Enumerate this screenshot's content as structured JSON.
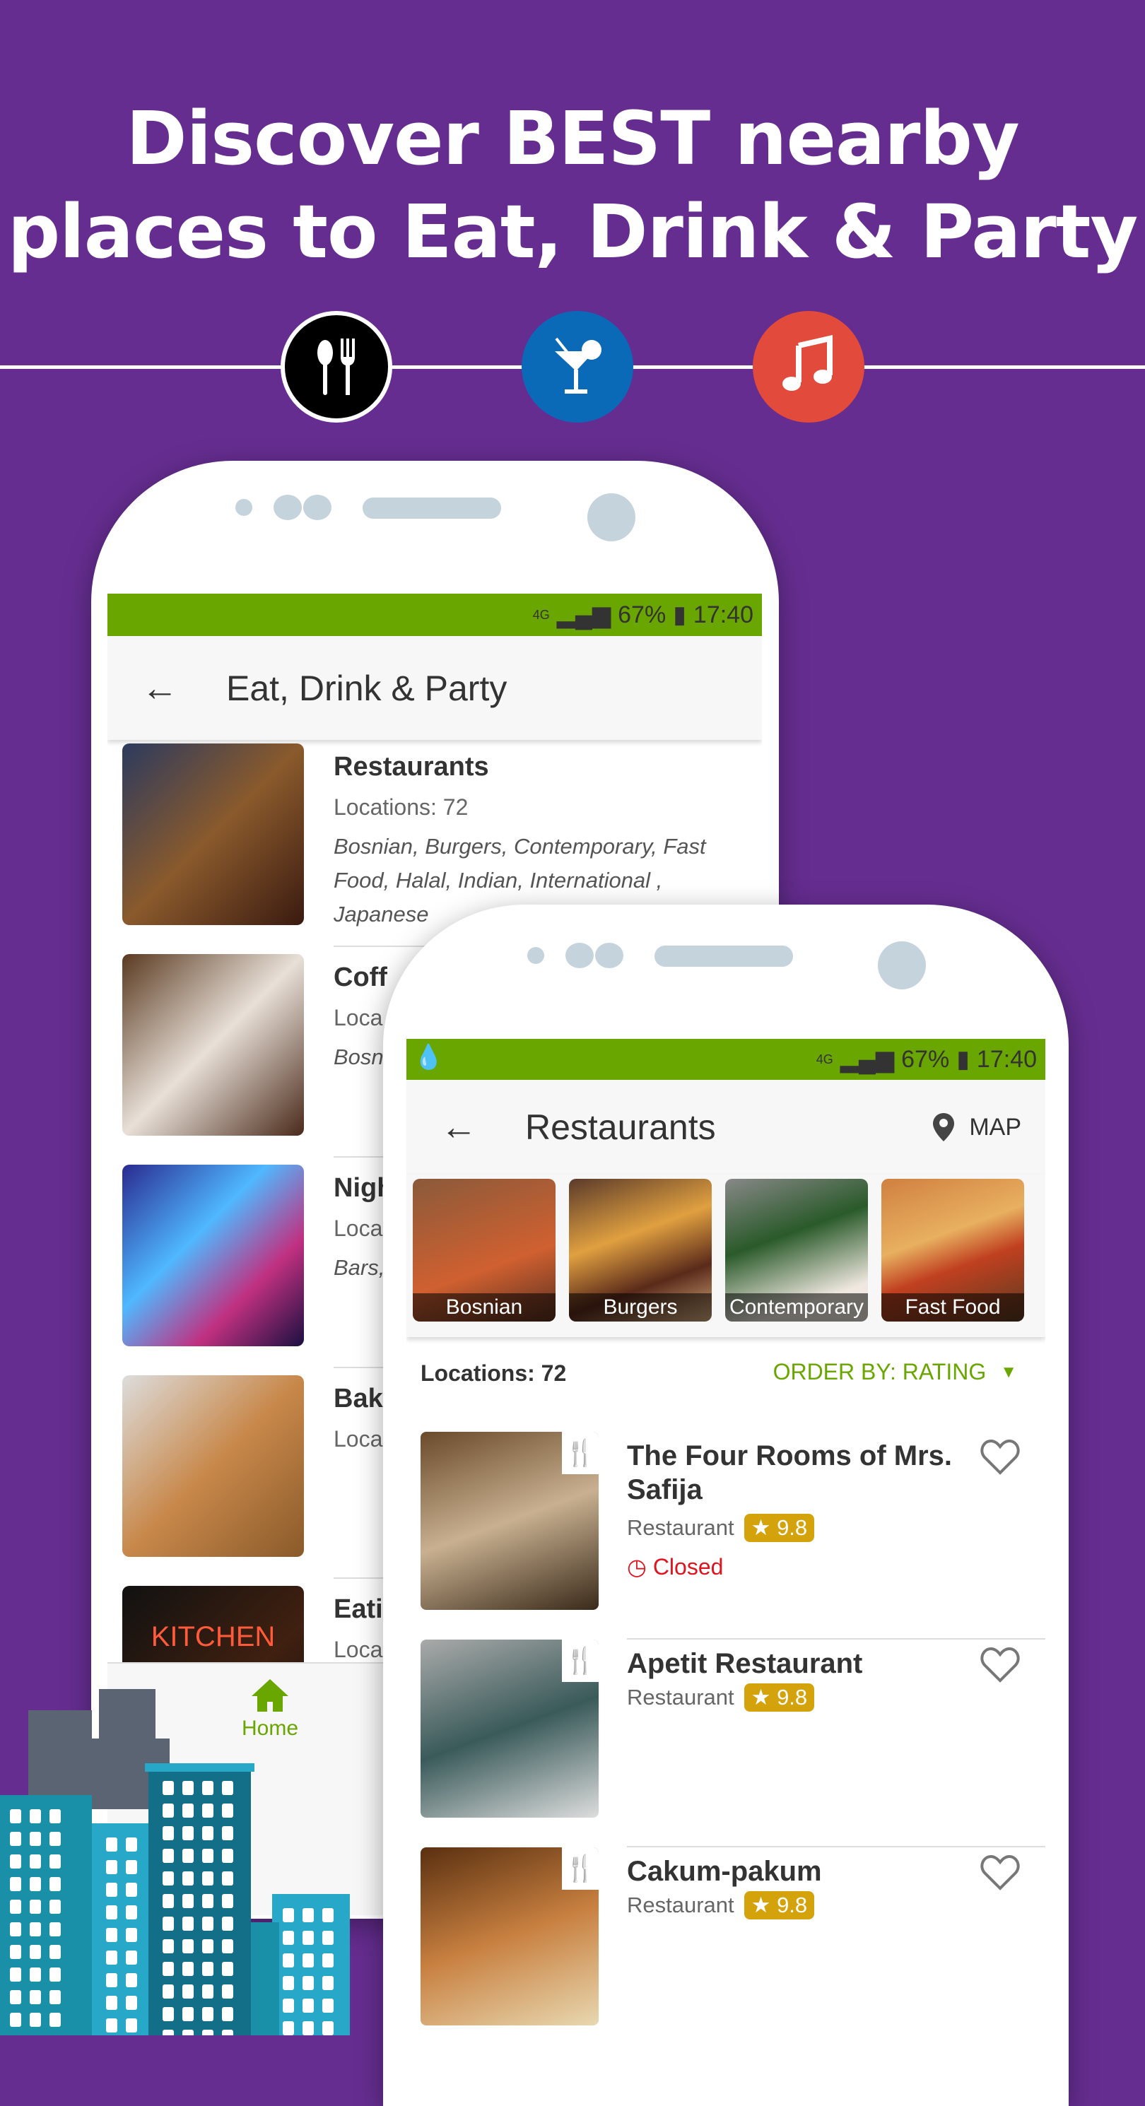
{
  "headline": {
    "line1": "Discover BEST nearby",
    "line2": "places to Eat, Drink & Party"
  },
  "category_icons": [
    {
      "icon": "fork-spoon-icon",
      "color": "#000000"
    },
    {
      "icon": "cocktail-icon",
      "color": "#0a6ab8"
    },
    {
      "icon": "music-note-icon",
      "color": "#e24a3b"
    }
  ],
  "colors": {
    "background": "#652d90",
    "accent": "#6aa600",
    "rating": "#d4a20a",
    "closed": "#e0141e"
  },
  "back_phone": {
    "status": {
      "network": "4G",
      "battery": "67%",
      "time": "17:40"
    },
    "title": "Eat, Drink & Party",
    "items": [
      {
        "title": "Restaurants",
        "sub": "Locations: 72",
        "tags": "Bosnian, Burgers, Contemporary, Fast Food, Halal, Indian, International , Japanese"
      },
      {
        "title": "Coff",
        "sub": "Loca",
        "tags": "Bosn Hook"
      },
      {
        "title": "Nigh",
        "sub": "Loca",
        "tags": "Bars,"
      },
      {
        "title": "Bak",
        "sub": "Loca",
        "tags": ""
      },
      {
        "title": "Eati",
        "sub": "Loca",
        "tags": ""
      }
    ],
    "image_text": "KITCHEN",
    "nav": {
      "home": "Home"
    }
  },
  "front_phone": {
    "status": {
      "network": "4G",
      "battery": "67%",
      "time": "17:40"
    },
    "title": "Restaurants",
    "map_label": "MAP",
    "categories": [
      "Bosnian",
      "Burgers",
      "Contemporary",
      "Fast Food"
    ],
    "locations": "Locations: 72",
    "order_by": "ORDER BY: RATING",
    "restaurants": [
      {
        "name": "The Four Rooms of Mrs. Safija",
        "type": "Restaurant",
        "rating": "9.8",
        "status": "Closed"
      },
      {
        "name": "Apetit Restaurant",
        "type": "Restaurant",
        "rating": "9.8"
      },
      {
        "name": "Cakum-pakum",
        "type": "Restaurant",
        "rating": "9.8"
      }
    ]
  }
}
